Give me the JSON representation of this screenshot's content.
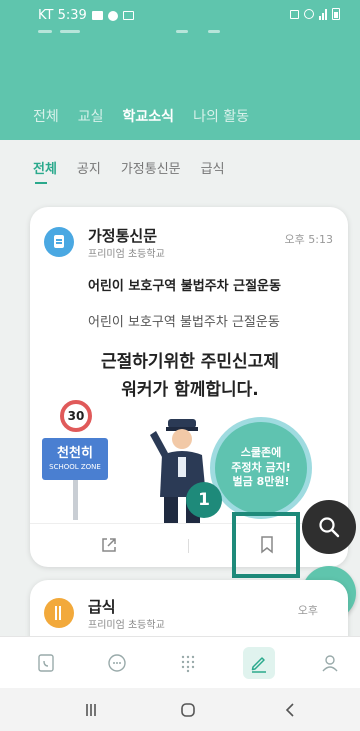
{
  "status_bar": {
    "carrier_time": "KT 5:39"
  },
  "main_tabs": [
    {
      "label": "전체",
      "active": false
    },
    {
      "label": "교실",
      "active": false
    },
    {
      "label": "학교소식",
      "active": true
    },
    {
      "label": "나의 활동",
      "active": false
    }
  ],
  "sub_tabs": [
    {
      "label": "전체",
      "active": true
    },
    {
      "label": "공지",
      "active": false
    },
    {
      "label": "가정통신문",
      "active": false
    },
    {
      "label": "급식",
      "active": false
    }
  ],
  "post": {
    "icon": "document-icon",
    "title": "가정통신문",
    "school": "프리미엄 초등학교",
    "time": "오후 5:13",
    "headline": "어린이 보호구역 불법주차 근절운동",
    "body": "어린이 보호구역 불법주차 근절운동",
    "poster": {
      "line1": "근절하기위한 주민신고제",
      "line2": "워커가 함께합니다.",
      "speed_limit": "30",
      "zone_big": "천천히",
      "zone_small": "SCHOOL ZONE",
      "bubble_line1": "스쿨존에",
      "bubble_line2": "주정차 금지!",
      "bubble_line3": "벌금 8만원!"
    }
  },
  "tutorial": {
    "step": "1"
  },
  "post2": {
    "icon": "utensils-icon",
    "title": "급식",
    "school": "프리미엄 초등학교",
    "time": "오후"
  },
  "bottom_nav": [
    "phone-icon",
    "chat-icon",
    "keypad-icon",
    "pencil-icon",
    "person-icon"
  ],
  "colors": {
    "header": "#5fc5ad",
    "accent": "#2aa98c",
    "highlight": "#1e8a7a"
  }
}
